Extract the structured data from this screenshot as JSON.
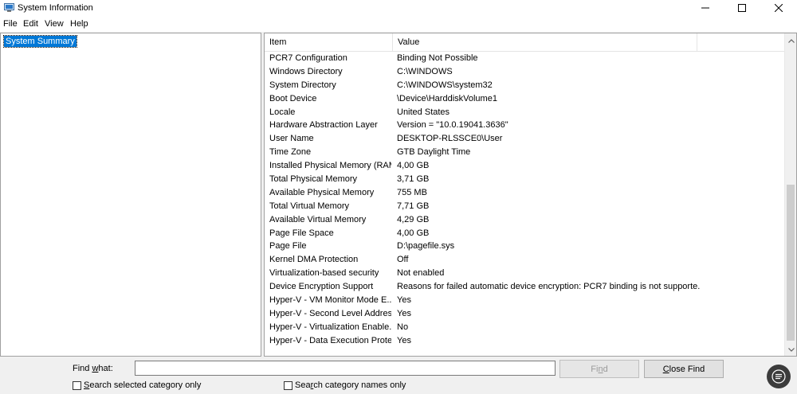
{
  "window": {
    "title": "System Information",
    "icon": "system-info-icon",
    "controls": [
      "minimize-icon",
      "maximize-icon",
      "close-icon"
    ]
  },
  "menu": {
    "file": "File",
    "edit": "Edit",
    "view": "View",
    "help": "Help"
  },
  "tree": {
    "selected_label": "System Summary"
  },
  "list": {
    "columns": {
      "item": "Item",
      "value": "Value"
    },
    "rows": [
      {
        "item": "PCR7 Configuration",
        "value": "Binding Not Possible"
      },
      {
        "item": "Windows Directory",
        "value": "C:\\WINDOWS"
      },
      {
        "item": "System Directory",
        "value": "C:\\WINDOWS\\system32"
      },
      {
        "item": "Boot Device",
        "value": "\\Device\\HarddiskVolume1"
      },
      {
        "item": "Locale",
        "value": "United States"
      },
      {
        "item": "Hardware Abstraction Layer",
        "value": "Version = \"10.0.19041.3636\""
      },
      {
        "item": "User Name",
        "value": "DESKTOP-RLSSCE0\\User"
      },
      {
        "item": "Time Zone",
        "value": "GTB Daylight Time"
      },
      {
        "item": "Installed Physical Memory (RAM)",
        "value": "4,00 GB"
      },
      {
        "item": "Total Physical Memory",
        "value": "3,71 GB"
      },
      {
        "item": "Available Physical Memory",
        "value": "755 MB"
      },
      {
        "item": "Total Virtual Memory",
        "value": "7,71 GB"
      },
      {
        "item": "Available Virtual Memory",
        "value": "4,29 GB"
      },
      {
        "item": "Page File Space",
        "value": "4,00 GB"
      },
      {
        "item": "Page File",
        "value": "D:\\pagefile.sys"
      },
      {
        "item": "Kernel DMA Protection",
        "value": "Off"
      },
      {
        "item": "Virtualization-based security",
        "value": "Not enabled"
      },
      {
        "item": "Device Encryption Support",
        "value": "Reasons for failed automatic device encryption: PCR7 binding is not supporte..."
      },
      {
        "item": "Hyper-V - VM Monitor Mode E...",
        "value": "Yes"
      },
      {
        "item": "Hyper-V - Second Level Addres...",
        "value": "Yes"
      },
      {
        "item": "Hyper-V - Virtualization Enable...",
        "value": "No"
      },
      {
        "item": "Hyper-V - Data Execution Prote...",
        "value": "Yes"
      }
    ]
  },
  "find": {
    "label_prefix": "Find ",
    "label_access": "w",
    "label_suffix": "hat:",
    "input_value": "",
    "find_prefix": "Fi",
    "find_access": "n",
    "find_suffix": "d",
    "close_access": "C",
    "close_suffix": "lose Find",
    "cb_selected_access": "S",
    "cb_selected_suffix": "earch selected category only",
    "cb_names_prefix": "Sea",
    "cb_names_access": "r",
    "cb_names_suffix": "ch category names only"
  },
  "colors": {
    "selection": "#0078d7",
    "pane_border": "#a0a0a0",
    "disabled_text": "#9a9a9a"
  }
}
